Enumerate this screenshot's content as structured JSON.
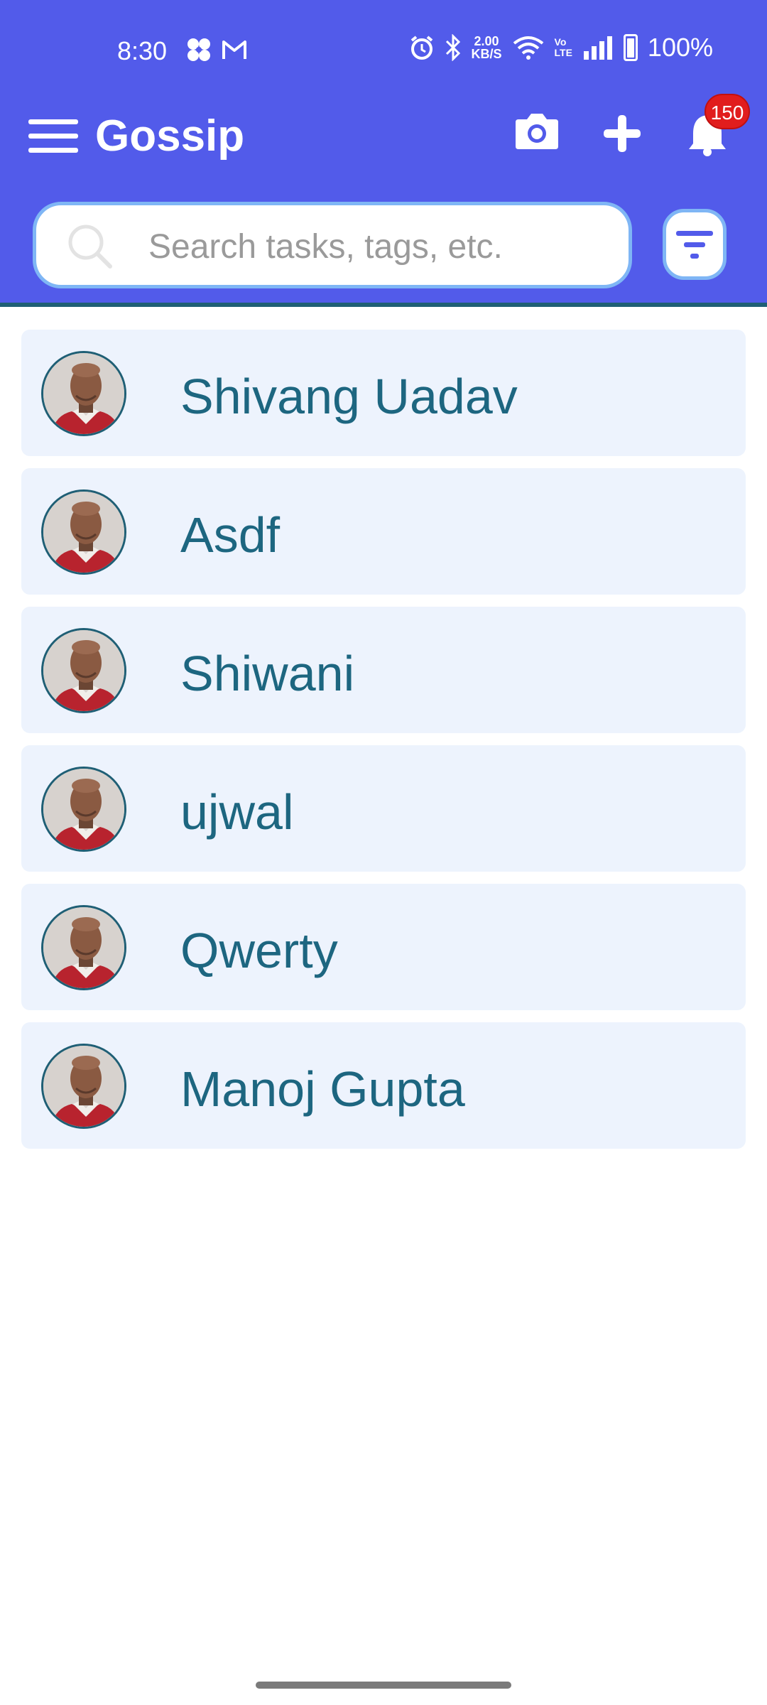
{
  "status_bar": {
    "time": "8:30",
    "left_icons": [
      "fan-icon",
      "gmail-icon"
    ],
    "right_icons": [
      "alarm-icon",
      "bluetooth-icon",
      "wifi-icon",
      "volte-icon",
      "signal-icon",
      "battery-icon"
    ],
    "network_speed_value": "2.00",
    "network_speed_unit": "KB/S",
    "volte_top": "Vo",
    "volte_bottom": "LTE",
    "battery": "100%"
  },
  "app_bar": {
    "title": "Gossip",
    "notification_count": "150",
    "icons": [
      "menu-icon",
      "camera-icon",
      "plus-icon",
      "bell-icon"
    ]
  },
  "search": {
    "placeholder": "Search tasks, tags, etc.",
    "value": ""
  },
  "contacts": [
    {
      "name": "Shivang Uadav"
    },
    {
      "name": "Asdf"
    },
    {
      "name": "Shiwani"
    },
    {
      "name": "ujwal"
    },
    {
      "name": "Qwerty"
    },
    {
      "name": "Manoj Gupta"
    }
  ],
  "colors": {
    "header": "#525bea",
    "accent_border": "#7fb6f5",
    "list_background": "#edf3fd",
    "list_text": "#1d6680",
    "badge": "#e11d1d"
  }
}
